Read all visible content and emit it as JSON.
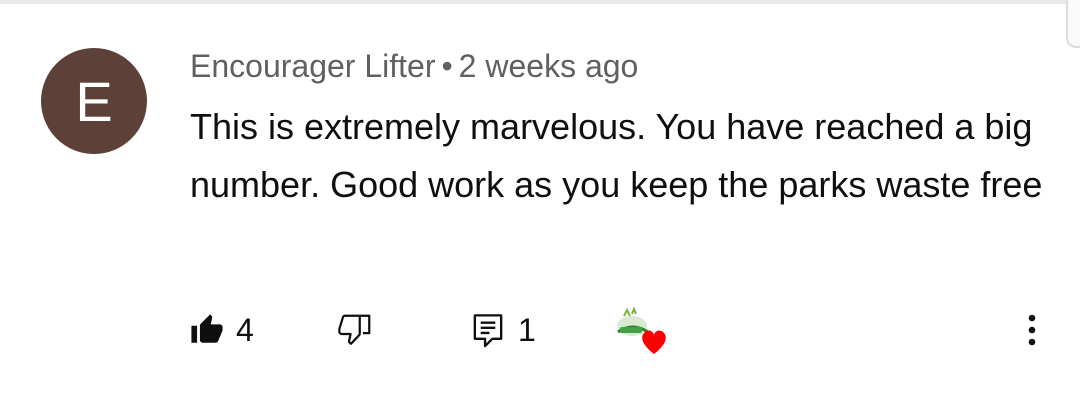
{
  "comment": {
    "avatar_letter": "E",
    "avatar_color": "#5d4037",
    "author": "Encourager Lifter",
    "separator": "•",
    "time": "2 weeks ago",
    "text": "This is extremely marvelous. You have reached a big number. Good work as you keep the parks waste free"
  },
  "actions": {
    "like_count": "4",
    "reply_count": "1",
    "icons": [
      "thumbs-up-icon",
      "thumbs-down-icon",
      "reply-icon",
      "creator-heart-icon",
      "more-vert-icon"
    ],
    "heart_color": "#ff0000"
  }
}
